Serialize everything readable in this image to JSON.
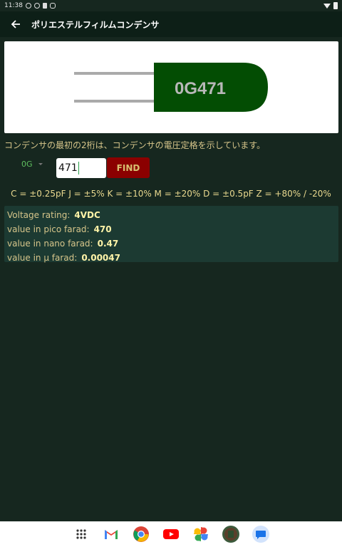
{
  "status_bar": {
    "time": "11:38"
  },
  "app_bar": {
    "title": "ポリエステルフィルムコンデンサ"
  },
  "capacitor": {
    "code_label": "0G471",
    "body_color": "#034d03"
  },
  "description": "コンデンサの最初の2桁は、コンデンサの電圧定格を示しています。",
  "finder": {
    "voltage_code": "0G",
    "input_value": "471",
    "find_label": "FIND"
  },
  "tolerance": "C = ±0.25pF J = ±5% K = ±10% M = ±20% D = ±0.5pF Z = +80% / -20%",
  "results": [
    {
      "label": "Voltage rating:",
      "value": "4VDC"
    },
    {
      "label": "value in pico farad:",
      "value": "470"
    },
    {
      "label": "value in nano farad:",
      "value": "0.47"
    },
    {
      "label": "value in μ farad:",
      "value": "0.00047"
    }
  ],
  "nav_apps": [
    "app-drawer-icon",
    "gmail-icon",
    "chrome-icon",
    "youtube-icon",
    "photos-icon",
    "capacitor-app-icon",
    "messages-icon"
  ]
}
